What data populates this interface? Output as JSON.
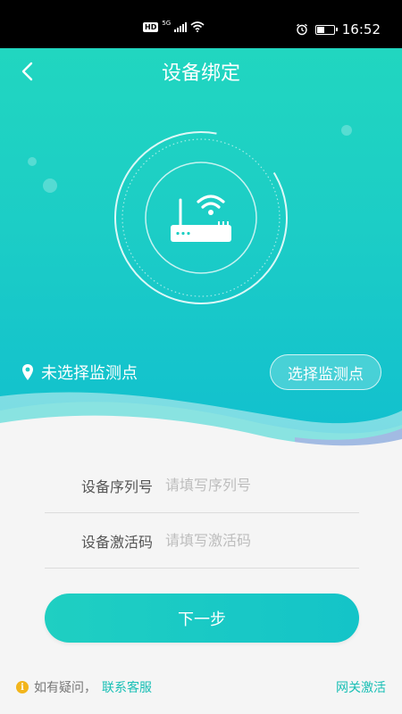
{
  "status_bar": {
    "hd": "HD",
    "network": "5G",
    "time": "16:52",
    "icons": [
      "hd-icon",
      "5g-signal-icon",
      "wifi-icon",
      "alarm-icon",
      "battery-icon"
    ]
  },
  "header": {
    "title": "设备绑定",
    "back_icon": "chevron-left-icon"
  },
  "device_illustration": {
    "icon": "router-wifi-icon"
  },
  "location": {
    "icon": "location-pin-icon",
    "text": "未选择监测点",
    "button_label": "选择监测点"
  },
  "form": {
    "serial": {
      "label": "设备序列号",
      "value": "",
      "placeholder": "请填写序列号"
    },
    "activation": {
      "label": "设备激活码",
      "value": "",
      "placeholder": "请填写激活码"
    }
  },
  "next_button": "下一步",
  "footer": {
    "info_icon": "info-icon",
    "question_text": "如有疑问，",
    "support_link": "联系客服",
    "gateway_link": "网关激活"
  },
  "colors": {
    "accent": "#1dcfc3",
    "link": "#17bfb5",
    "info": "#f2b51c"
  }
}
